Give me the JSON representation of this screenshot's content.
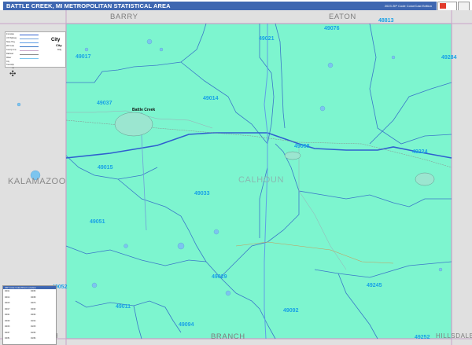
{
  "header": {
    "title": "BATTLE CREEK, MI METROPOLITAN STATISTICAL AREA",
    "edition": "2023 ZIP Code Color/Cast Edition"
  },
  "colors": {
    "title_bar": "#3f67b1",
    "county_fill": "#7df5cf",
    "outer_fill": "#e0e0e0",
    "zip_label": "#18a1e6",
    "zip_boundary": "#3a78c8"
  },
  "counties": {
    "home": "CALHOUN",
    "barry": "BARRY",
    "eaton": "EATON",
    "kalamazoo": "KALAMAZOO",
    "branch": "BRANCH",
    "hillsdale": "HILLSDALE",
    "branch_partial": "PH"
  },
  "city_label": "Battle Creek",
  "zip_codes": [
    "49021",
    "49076",
    "48813",
    "49017",
    "49284",
    "49014",
    "49037",
    "49068",
    "49224",
    "49015",
    "49033",
    "49051",
    "49092",
    "49029",
    "49052",
    "49011",
    "49245",
    "49094",
    "49252"
  ],
  "legend_rows": [
    "Interstate",
    "US Highway",
    "State Hwy",
    "ZIP Code",
    "County Line",
    "Railroad",
    "Water",
    "City",
    "Township"
  ],
  "index_header": "ZIP Code Index/Post Location",
  "index_cells": [
    "49011",
    "49014",
    "49015",
    "49017",
    "49021",
    "49029",
    "49033",
    "49037",
    "49051",
    "49052",
    "49068",
    "49076",
    "49092",
    "49094",
    "49224",
    "49245",
    "49252",
    "49284"
  ],
  "compass": "N"
}
